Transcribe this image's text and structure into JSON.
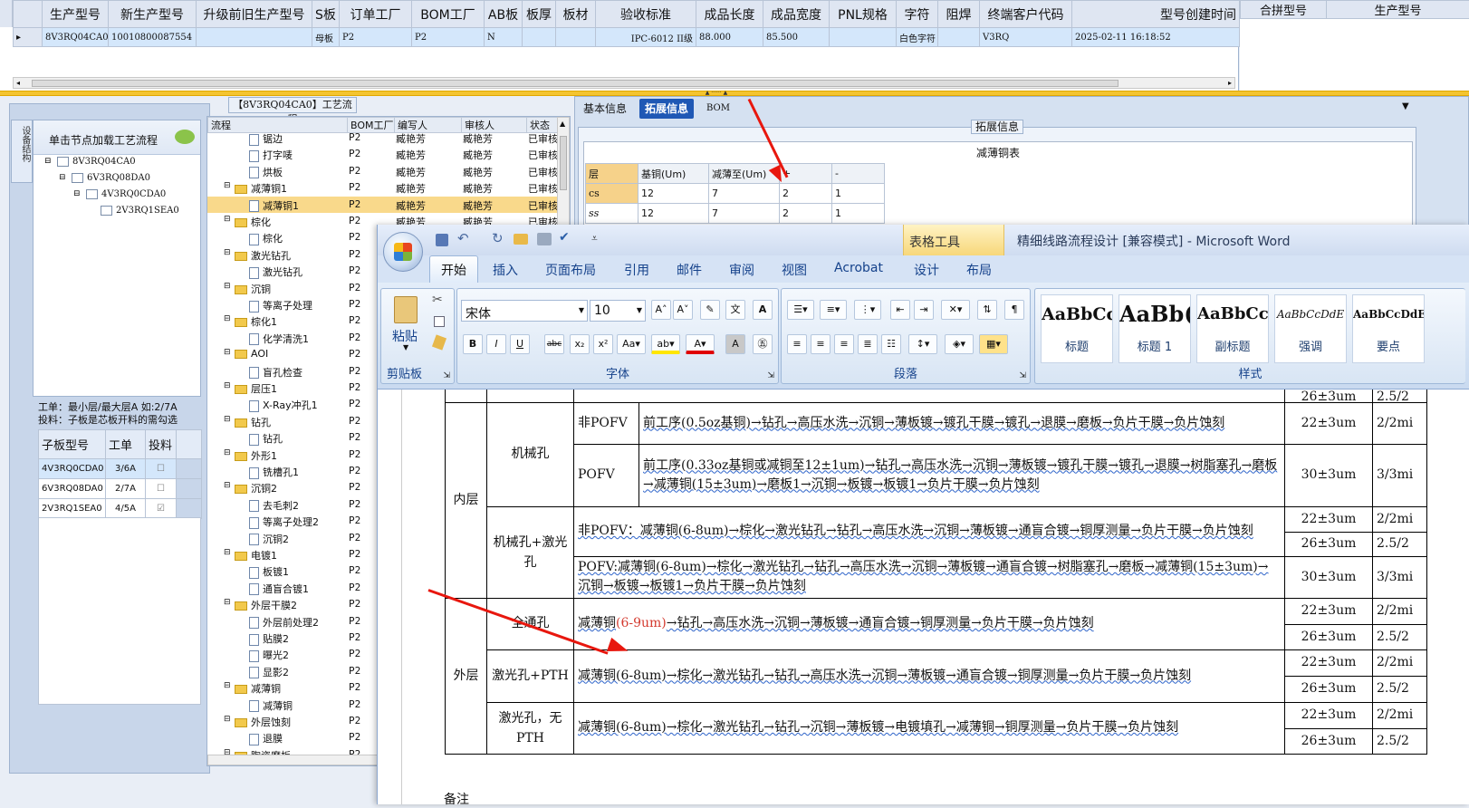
{
  "top_grid": {
    "headers": [
      "生产型号",
      "新生产型号",
      "升级前旧生产型号",
      "S板",
      "订单工厂",
      "BOM工厂",
      "AB板",
      "板厚",
      "板材",
      "验收标准",
      "成品长度",
      "成品宽度",
      "PNL规格",
      "字符",
      "阻焊",
      "终端客户代码",
      "型号创建时间"
    ],
    "row": {
      "prod_model": "8V3RQ04CA0",
      "new_model": "10010800087554",
      "old_model": "",
      "s_board": "母板",
      "order_factory": "P2",
      "bom_factory": "P2",
      "ab_board": "N",
      "thickness": "",
      "material": "",
      "standard": "IPC-6012 II级",
      "length": "88.000",
      "width": "85.500",
      "pnl": "",
      "char": "白色字符",
      "solder": "",
      "customer": "V3RQ",
      "created": "2025-02-11 16:18:52"
    },
    "merge_headers": [
      "合拼型号",
      "生产型号"
    ],
    "row_indicator": "▸"
  },
  "flow_title": "【8V3RQ04CA0】工艺流程",
  "left_panel": {
    "side_tab": "设备结构",
    "hint": "单击节点加载工艺流程",
    "tree": [
      {
        "label": "8V3RQ04CA0",
        "level": 0
      },
      {
        "label": "6V3RQ08DA0",
        "level": 1
      },
      {
        "label": "4V3RQ0CDA0",
        "level": 2
      },
      {
        "label": "2V3RQ1SEA0",
        "level": 3
      }
    ],
    "note1": "工单：最小层/最大层A 如:2/7A",
    "note2": "投料：子板是芯板开料的需勾选",
    "sub_headers": [
      "子板型号",
      "工单",
      "投料"
    ],
    "sub_rows": [
      {
        "model": "4V3RQ0CDA0",
        "order": "3/6A",
        "feed": "☐"
      },
      {
        "model": "6V3RQ08DA0",
        "order": "2/7A",
        "feed": "☐"
      },
      {
        "model": "2V3RQ1SEA0",
        "order": "4/5A",
        "feed": "☑"
      }
    ]
  },
  "flow_grid": {
    "headers": [
      "流程",
      "BOM工厂",
      "编写人",
      "审核人",
      "状态"
    ],
    "rows": [
      {
        "name": "锯边",
        "type": "item",
        "factory": "P2",
        "writer": "臧艳芳",
        "reviewer": "臧艳芳",
        "status": "已审核"
      },
      {
        "name": "打字唛",
        "type": "item",
        "factory": "P2",
        "writer": "臧艳芳",
        "reviewer": "臧艳芳",
        "status": "已审核"
      },
      {
        "name": "烘板",
        "type": "item",
        "factory": "P2",
        "writer": "臧艳芳",
        "reviewer": "臧艳芳",
        "status": "已审核"
      },
      {
        "name": "减薄铜1",
        "type": "folder",
        "factory": "P2",
        "writer": "臧艳芳",
        "reviewer": "臧艳芳",
        "status": "已审核"
      },
      {
        "name": "减薄铜1",
        "type": "item",
        "factory": "P2",
        "writer": "臧艳芳",
        "reviewer": "臧艳芳",
        "status": "已审核",
        "selected": true
      },
      {
        "name": "棕化",
        "type": "folder",
        "factory": "P2",
        "writer": "臧艳芳",
        "reviewer": "臧艳芳",
        "status": "已审核"
      },
      {
        "name": "棕化",
        "type": "item",
        "factory": "P2",
        "writer": "",
        "reviewer": "",
        "status": ""
      },
      {
        "name": "激光钻孔",
        "type": "folder",
        "factory": "P2",
        "writer": "",
        "reviewer": "",
        "status": ""
      },
      {
        "name": "激光钻孔",
        "type": "item",
        "factory": "P2",
        "writer": "",
        "reviewer": "",
        "status": ""
      },
      {
        "name": "沉铜",
        "type": "folder",
        "factory": "P2",
        "writer": "",
        "reviewer": "",
        "status": ""
      },
      {
        "name": "等离子处理",
        "type": "item",
        "factory": "P2",
        "writer": "",
        "reviewer": "",
        "status": ""
      },
      {
        "name": "棕化1",
        "type": "folder",
        "factory": "P2",
        "writer": "",
        "reviewer": "",
        "status": ""
      },
      {
        "name": "化学清洗1",
        "type": "item",
        "factory": "P2",
        "writer": "",
        "reviewer": "",
        "status": ""
      },
      {
        "name": "AOI",
        "type": "folder",
        "factory": "P2",
        "writer": "",
        "reviewer": "",
        "status": ""
      },
      {
        "name": "盲孔检查",
        "type": "item",
        "factory": "P2",
        "writer": "",
        "reviewer": "",
        "status": ""
      },
      {
        "name": "层压1",
        "type": "folder",
        "factory": "P2",
        "writer": "",
        "reviewer": "",
        "status": ""
      },
      {
        "name": "X-Ray冲孔1",
        "type": "item",
        "factory": "P2",
        "writer": "",
        "reviewer": "",
        "status": ""
      },
      {
        "name": "钻孔",
        "type": "folder",
        "factory": "P2",
        "writer": "",
        "reviewer": "",
        "status": ""
      },
      {
        "name": "钻孔",
        "type": "item",
        "factory": "P2",
        "writer": "",
        "reviewer": "",
        "status": ""
      },
      {
        "name": "外形1",
        "type": "folder",
        "factory": "P2",
        "writer": "",
        "reviewer": "",
        "status": ""
      },
      {
        "name": "铣槽孔1",
        "type": "item",
        "factory": "P2",
        "writer": "",
        "reviewer": "",
        "status": ""
      },
      {
        "name": "沉铜2",
        "type": "folder",
        "factory": "P2",
        "writer": "",
        "reviewer": "",
        "status": ""
      },
      {
        "name": "去毛刺2",
        "type": "item",
        "factory": "P2",
        "writer": "",
        "reviewer": "",
        "status": ""
      },
      {
        "name": "等离子处理2",
        "type": "item",
        "factory": "P2",
        "writer": "",
        "reviewer": "",
        "status": ""
      },
      {
        "name": "沉铜2",
        "type": "item",
        "factory": "P2",
        "writer": "",
        "reviewer": "",
        "status": ""
      },
      {
        "name": "电镀1",
        "type": "folder",
        "factory": "P2",
        "writer": "",
        "reviewer": "",
        "status": ""
      },
      {
        "name": "板镀1",
        "type": "item",
        "factory": "P2",
        "writer": "",
        "reviewer": "",
        "status": ""
      },
      {
        "name": "通盲合镀1",
        "type": "item",
        "factory": "P2",
        "writer": "",
        "reviewer": "",
        "status": ""
      },
      {
        "name": "外层干膜2",
        "type": "folder",
        "factory": "P2",
        "writer": "",
        "reviewer": "",
        "status": ""
      },
      {
        "name": "外层前处理2",
        "type": "item",
        "factory": "P2",
        "writer": "",
        "reviewer": "",
        "status": ""
      },
      {
        "name": "贴膜2",
        "type": "item",
        "factory": "P2",
        "writer": "",
        "reviewer": "",
        "status": ""
      },
      {
        "name": "曝光2",
        "type": "item",
        "factory": "P2",
        "writer": "",
        "reviewer": "",
        "status": ""
      },
      {
        "name": "显影2",
        "type": "item",
        "factory": "P2",
        "writer": "",
        "reviewer": "",
        "status": ""
      },
      {
        "name": "减薄铜",
        "type": "folder",
        "factory": "P2",
        "writer": "",
        "reviewer": "",
        "status": ""
      },
      {
        "name": "减薄铜",
        "type": "item",
        "factory": "P2",
        "writer": "",
        "reviewer": "",
        "status": ""
      },
      {
        "name": "外层蚀刻",
        "type": "folder",
        "factory": "P2",
        "writer": "",
        "reviewer": "",
        "status": ""
      },
      {
        "name": "退膜",
        "type": "item",
        "factory": "P2",
        "writer": "",
        "reviewer": "",
        "status": ""
      },
      {
        "name": "陶瓷磨板",
        "type": "folder",
        "factory": "P2",
        "writer": "",
        "reviewer": "",
        "status": ""
      }
    ]
  },
  "right_panel": {
    "tabs": [
      "基本信息",
      "拓展信息",
      "BOM"
    ],
    "section": "拓展信息",
    "table_title": "减薄铜表",
    "headers": [
      "层",
      "基铜(Um)",
      "减薄至(Um)",
      "+",
      "-"
    ],
    "rows": [
      {
        "layer": "cs",
        "base": "12",
        "thin": "7",
        "plus": "2",
        "minus": "1"
      },
      {
        "layer": "ss",
        "base": "12",
        "thin": "7",
        "plus": "2",
        "minus": "1"
      }
    ]
  },
  "word": {
    "title": "精细线路流程设计 [兼容模式] - Microsoft Word",
    "contextual": "表格工具",
    "tabs": [
      "开始",
      "插入",
      "页面布局",
      "引用",
      "邮件",
      "审阅",
      "视图",
      "Acrobat",
      "设计",
      "布局"
    ],
    "font_name": "宋体",
    "font_size": "10",
    "paste": "粘贴",
    "groups": [
      "剪贴板",
      "字体",
      "段落",
      "样式"
    ],
    "styles": [
      {
        "preview": "AaBbCc",
        "name": "标题"
      },
      {
        "preview": "AaBb(",
        "name": "标题 1"
      },
      {
        "preview": "AaBbCc",
        "name": "副标题"
      },
      {
        "preview": "AaBbCcDdE",
        "name": "强调"
      },
      {
        "preview": "AaBbCcDdE",
        "name": "要点"
      }
    ],
    "table": {
      "inner": "内层",
      "outer": "外层",
      "mech": "机械孔",
      "mech_laser": "机械孔+激光孔",
      "through": "全通孔",
      "laser_pth": "激光孔+PTH",
      "laser_nopth": "激光孔，无PTH",
      "non_pofv": "非POFV",
      "pofv": "POFV",
      "flow1": "前工序(0.5oz基铜)→钻孔→高压水洗→沉铜→薄板镀→镀孔干膜→镀孔→退膜→磨板→负片干膜→负片蚀刻",
      "flow2": "前工序(0.33oz基铜或减铜至12±1um)→钻孔→高压水洗→沉铜→薄板镀→镀孔干膜→镀孔→退膜→树脂塞孔→磨板→减薄铜(15±3um)→磨板1→沉铜→板镀→板镀1→负片干膜→负片蚀刻",
      "flow3": "非POFV：减薄铜(6-8um)→棕化→激光钻孔→钻孔→高压水洗→沉铜→薄板镀→通盲合镀→铜厚测量→负片干膜→负片蚀刻",
      "flow4": "POFV:减薄铜(6-8um)→棕化→激光钻孔→钻孔→高压水洗→沉铜→薄板镀→通盲合镀→树脂塞孔→磨板→减薄铜(15±3um)→沉铜→板镀→板镀1→负片干膜→负片蚀刻",
      "flow5_a": "减薄铜",
      "flow5_red": "(6-9um)",
      "flow5_b": "→钻孔→高压水洗→沉铜→薄板镀→通盲合镀→铜厚测量→负片干膜→负片蚀刻",
      "flow6": "减薄铜(6-8um)→棕化→激光钻孔→钻孔→高压水洗→沉铜→薄板镀→通盲合镀→铜厚测量→负片干膜→负片蚀刻",
      "flow7": "减薄铜(6-8um)→棕化→激光钻孔→钻孔→沉铜→薄板镀→电镀填孔→减薄铜→铜厚测量→负片干膜→负片蚀刻",
      "t_top": "26±3um",
      "t22": "22±3um",
      "t26": "26±3um",
      "t30": "30±3um",
      "r_top": "2.5/2",
      "r22": "2/2mi",
      "r25": "2.5/2",
      "r33": "3/3mi",
      "remark": "备注"
    }
  }
}
